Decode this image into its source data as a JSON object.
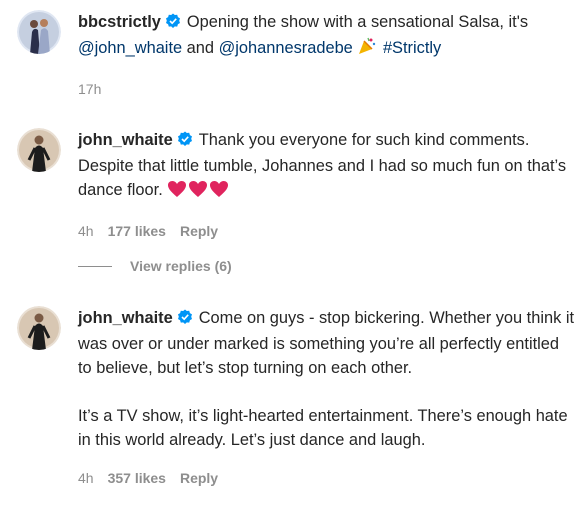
{
  "comments": [
    {
      "username": "bbcstrictly",
      "text_parts": {
        "a": "Opening the show with a sensational Salsa, it's",
        "mention1": "@john_whaite",
        "and": " and ",
        "mention2": "@johannesradebe",
        "hashtag": "#Strictly"
      },
      "emoji": "party-popper-icon",
      "time": "17h"
    },
    {
      "username": "john_whaite",
      "text": "Thank you everyone for such kind comments. Despite that little tumble, Johannes and I had so much fun on that’s dance floor.",
      "emoji": "red-heart-icon ×3",
      "time": "4h",
      "likes": "177 likes",
      "reply": "Reply",
      "view_replies": "View replies (6)"
    },
    {
      "username": "john_whaite",
      "text": "Come on guys - stop bickering. Whether you think it was over or under marked is something you’re all perfectly entitled to believe, but let’s stop turning on each other.",
      "text2": "It’s a TV show, it’s light-hearted entertainment. There’s enough hate in this world already. Let’s just dance and laugh.",
      "time": "4h",
      "likes": "357 likes",
      "reply": "Reply"
    }
  ],
  "colors": {
    "link": "#00376b",
    "muted": "#8e8e8e",
    "verified": "#0095f6",
    "heart": "#e0245e"
  }
}
